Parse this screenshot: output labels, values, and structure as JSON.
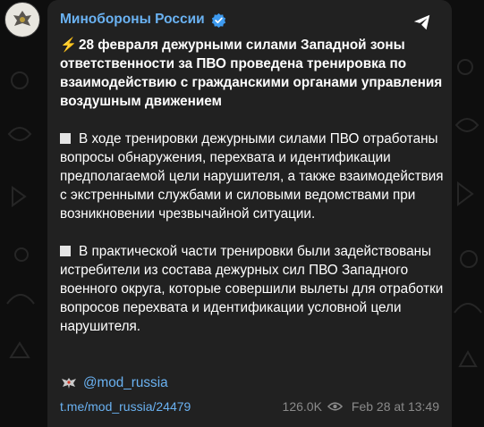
{
  "channel": {
    "name": "Минобороны России",
    "verified_icon": "verified-badge-icon",
    "avatar_icon": "emblem-avatar"
  },
  "post": {
    "paragraphs": [
      {
        "prefix_icon": "lightning-icon",
        "prefix_glyph": "⚡",
        "text": "28 февраля дежурными силами Западной зоны ответственности за ПВО проведена тренировка по взаимодействию с гражданскими органами управления воздушным движением",
        "bold": true
      },
      {
        "prefix_icon": "square-bullet-icon",
        "text": "В ходе тренировки дежурными силами ПВО отработаны вопросы обнаружения, перехвата и идентификации предполагаемой цели нарушителя, а также взаимодействия с экстренными службами и силовыми ведомствами при возникновении чрезвычайной ситуации.",
        "bold": false
      },
      {
        "prefix_icon": "square-bullet-icon",
        "text": "В практической части тренировки были задействованы истребители из состава дежурных сил ПВО Западного военного округа, которые совершили вылеты для отработки вопросов перехвата и идентификации условной цели нарушителя.",
        "bold": false
      }
    ],
    "handle": "@mod_russia",
    "handle_icon": "eagle-emblem-icon"
  },
  "footer": {
    "link": "t.me/mod_russia/24479",
    "views": "126.0K",
    "views_icon": "eye-icon",
    "date": "Feb 28 at 13:49"
  },
  "colors": {
    "accent": "#6ab2f2",
    "card_bg": "#212121",
    "page_bg": "#0e0e0e",
    "meta_text": "#8a8a8a"
  }
}
